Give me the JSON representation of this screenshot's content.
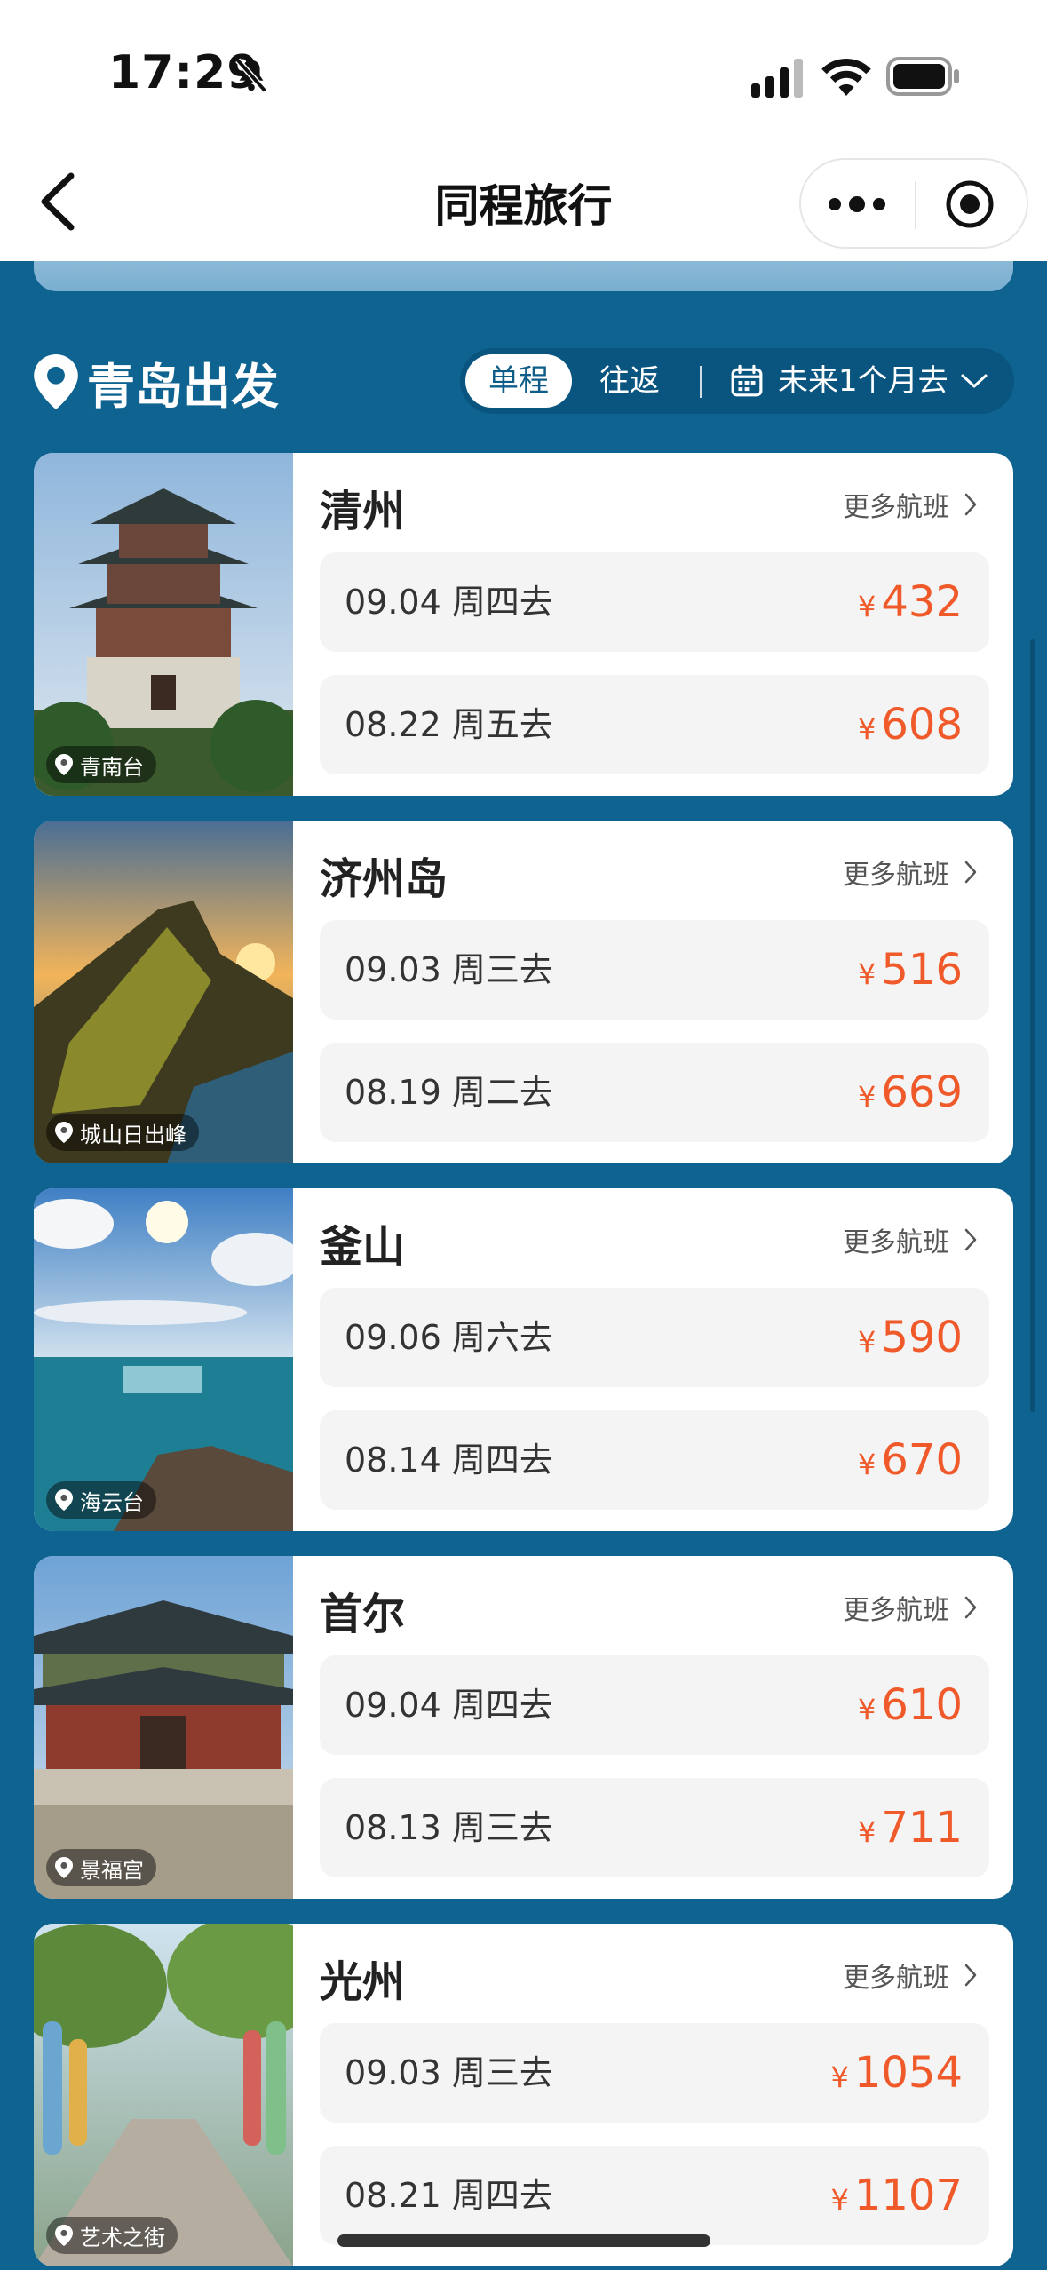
{
  "status_bar": {
    "time": "17:29",
    "icons": [
      "bell-slash-icon",
      "signal-icon",
      "wifi-icon",
      "battery-icon"
    ]
  },
  "nav": {
    "title": "同程旅行",
    "back_icon": "chevron-left-icon",
    "menu_icons": [
      "more-icon",
      "close-target-icon"
    ]
  },
  "header": {
    "origin": "青岛出发",
    "trip_types": [
      "单程",
      "往返"
    ],
    "selected_trip_type": "单程",
    "date_range": "未来1个月去"
  },
  "more_label": "更多航班",
  "destinations": [
    {
      "city": "清州",
      "landmark": "青南台",
      "flights": [
        {
          "date": "09.04  周四去",
          "currency": "¥",
          "price": "432"
        },
        {
          "date": "08.22  周五去",
          "currency": "¥",
          "price": "608"
        }
      ]
    },
    {
      "city": "济州岛",
      "landmark": "城山日出峰",
      "flights": [
        {
          "date": "09.03  周三去",
          "currency": "¥",
          "price": "516"
        },
        {
          "date": "08.19  周二去",
          "currency": "¥",
          "price": "669"
        }
      ]
    },
    {
      "city": "釜山",
      "landmark": "海云台",
      "flights": [
        {
          "date": "09.06  周六去",
          "currency": "¥",
          "price": "590"
        },
        {
          "date": "08.14  周四去",
          "currency": "¥",
          "price": "670"
        }
      ]
    },
    {
      "city": "首尔",
      "landmark": "景福宫",
      "flights": [
        {
          "date": "09.04  周四去",
          "currency": "¥",
          "price": "610"
        },
        {
          "date": "08.13  周三去",
          "currency": "¥",
          "price": "711"
        }
      ]
    },
    {
      "city": "光州",
      "landmark": "艺术之街",
      "flights": [
        {
          "date": "09.03  周三去",
          "currency": "¥",
          "price": "1054"
        },
        {
          "date": "08.21  周四去",
          "currency": "¥",
          "price": "1107"
        }
      ]
    }
  ],
  "colors": {
    "page_bg": "#0e6391",
    "price": "#f05a2a",
    "row_bg": "#f4f4f4"
  }
}
